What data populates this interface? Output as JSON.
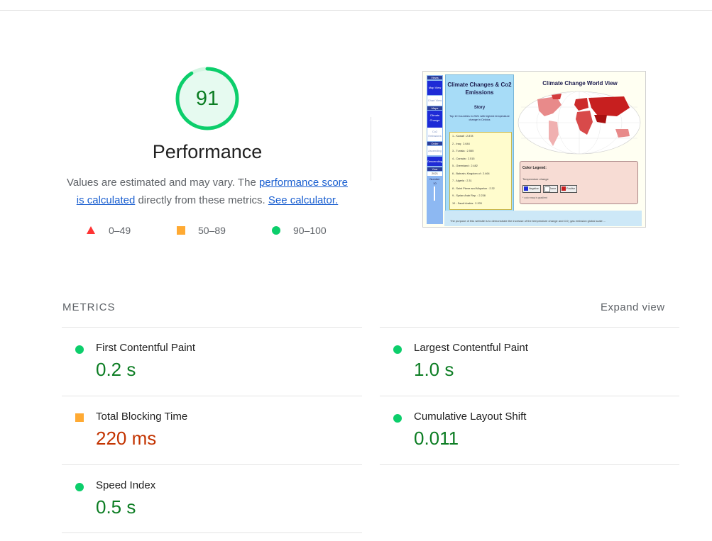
{
  "performance": {
    "score": "91",
    "score_fraction": 0.91,
    "title": "Performance",
    "desc_prefix": "Values are estimated and may vary. The ",
    "link_score": "performance score is calculated",
    "desc_mid": " directly from these metrics. ",
    "link_calculator": "See calculator."
  },
  "legend": [
    {
      "shape": "triangle",
      "label": "0–49",
      "color": "#ff3333"
    },
    {
      "shape": "square",
      "label": "50–89",
      "color": "#ffaa33"
    },
    {
      "shape": "circle",
      "label": "90–100",
      "color": "#0cce6b"
    }
  ],
  "thumbnail": {
    "nav": [
      "Views",
      "Map View",
      "Chart View",
      "Maps",
      "Climate Change",
      "Co2 Emissions",
      "Order",
      "Ascending",
      "Descending",
      "Year",
      "2021",
      "Number",
      "10"
    ],
    "story_title": "Climate Changes & Co2 Emissions",
    "story_sub": "Story",
    "story_caption": "Top 10 Countries in 2021 with highest temperature change in Celcius",
    "list": [
      "1 - Kuwait : 2.878",
      "2 - Iraq : 2.644",
      "3 - Tunisia : 2.555",
      "4 - Canada : 2.515",
      "5 - Greenland : 2.482",
      "6 - Bahrain, Kingdom of : 2.464",
      "7 - Algeria : 2.31",
      "8 - Saint Pierre and Miquelon : 2.32",
      "9 - Syrian Arab Rep. : 2.238",
      "10 - Saudi Arabia : 2.203"
    ],
    "map_title": "Climate Change World View",
    "legend_title": "Color Legend:",
    "legend_sub": "Temperature change",
    "legend_buttons": [
      "Negative",
      "Same",
      "Positive"
    ],
    "legend_note": "* color map is gradient",
    "bottom_text": "The purpose of this website is to demonstrate the increase of the temperature change and CO₂ gas emission global scale ..."
  },
  "metrics": {
    "header": "METRICS",
    "expand_label": "Expand view",
    "items": [
      {
        "name": "First Contentful Paint",
        "value": "0.2 s",
        "rating": "pass"
      },
      {
        "name": "Largest Contentful Paint",
        "value": "1.0 s",
        "rating": "pass"
      },
      {
        "name": "Total Blocking Time",
        "value": "220 ms",
        "rating": "average"
      },
      {
        "name": "Cumulative Layout Shift",
        "value": "0.011",
        "rating": "pass"
      },
      {
        "name": "Speed Index",
        "value": "0.5 s",
        "rating": "pass"
      }
    ]
  },
  "colors": {
    "pass": "#0cce6b",
    "pass_text": "#0c7d23",
    "average": "#ffaa33",
    "average_text": "#c33300",
    "fail": "#ff3333",
    "link": "#1a5fd0"
  }
}
